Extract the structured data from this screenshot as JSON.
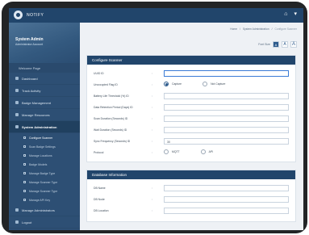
{
  "app": {
    "name": "NOTIFY"
  },
  "topbar": {
    "home_icon": "home-icon",
    "caret_icon": "caret-down-icon"
  },
  "sidebar": {
    "profile_title": "System Admin",
    "profile_sub": "Administrator Account",
    "welcome": "Welcome Page",
    "items": [
      {
        "label": "Dashboard",
        "icon": "dashboard-icon"
      },
      {
        "label": "Track Activity",
        "icon": "activity-icon"
      },
      {
        "label": "Badge Management",
        "icon": "badge-icon"
      },
      {
        "label": "Manage Resources",
        "icon": "resources-icon"
      },
      {
        "label": "System Administration",
        "icon": "admin-icon"
      }
    ],
    "subitems": [
      {
        "label": "Configure Scanner",
        "icon": "scanner-icon"
      },
      {
        "label": "Scan Badge Settings",
        "icon": "settings-icon"
      },
      {
        "label": "Manage Locations",
        "icon": "location-icon"
      },
      {
        "label": "Badge Models",
        "icon": "model-icon"
      },
      {
        "label": "Manage Badge Type",
        "icon": "type-icon"
      },
      {
        "label": "Manage Scanner Type",
        "icon": "scanner-type-icon"
      },
      {
        "label": "Manage Scanner Type",
        "icon": "scanner-type-icon"
      },
      {
        "label": "Manage API Key",
        "icon": "key-icon"
      }
    ],
    "bottom_items": [
      {
        "label": "Manage Administrators",
        "icon": "users-icon"
      },
      {
        "label": "Logout",
        "icon": "logout-icon"
      }
    ]
  },
  "breadcrumb": {
    "home": "Home",
    "section": "System Administration",
    "current": "Configure Scanner"
  },
  "font_size": {
    "label": "Font Size",
    "options": [
      "A",
      "A",
      "A"
    ]
  },
  "configure": {
    "header": "Configure Scanner",
    "fields": [
      {
        "label": "UUID ID",
        "value": ""
      },
      {
        "label": "Unoccupied Flag ID",
        "type": "radio",
        "options": [
          "Capture",
          "Not Capture"
        ],
        "selected": 0
      },
      {
        "label": "Battery Life Threshold (%) ID",
        "value": ""
      },
      {
        "label": "Data Retention Period (Days) ID",
        "value": ""
      },
      {
        "label": "Scan Duration (Seconds) ID",
        "value": ""
      },
      {
        "label": "Wait Duration (Seconds) ID",
        "value": ""
      },
      {
        "label": "Sync Frequency (Seconds) ID",
        "value": "30"
      },
      {
        "label": "Protocol",
        "type": "radio",
        "options": [
          "MQTT",
          "API"
        ],
        "selected": 0
      }
    ]
  },
  "database": {
    "header": "Database Information",
    "fields": [
      {
        "label": "DB Name",
        "value": ""
      },
      {
        "label": "DB Node",
        "value": ""
      },
      {
        "label": "DB Location",
        "value": ""
      }
    ]
  }
}
